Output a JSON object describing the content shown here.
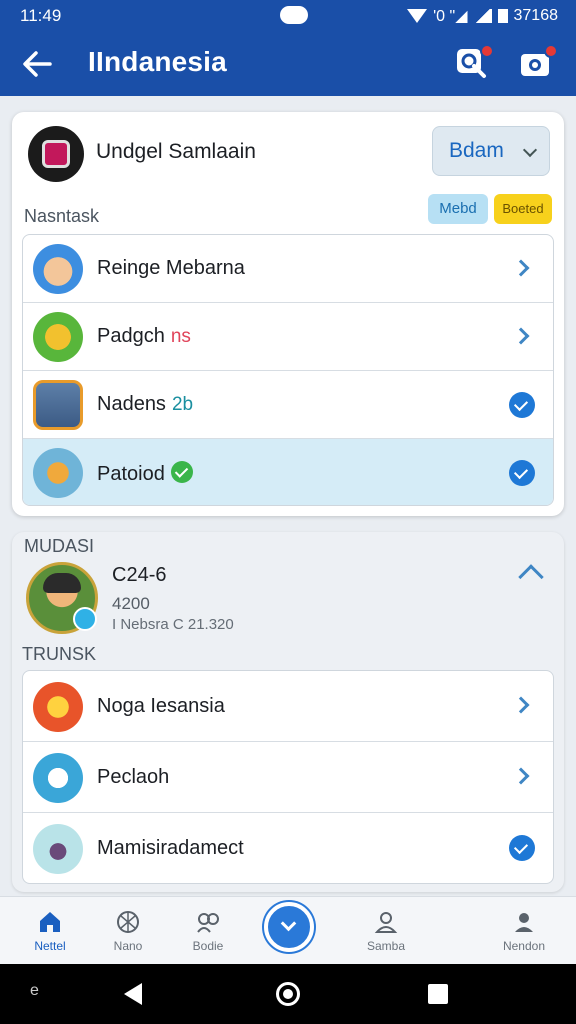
{
  "status_bar": {
    "time": "11:49",
    "right_text": "'0 \"◢",
    "battery_text": "37168"
  },
  "header": {
    "title": "IIndanesia",
    "back_icon": "arrow-left-icon",
    "actions": [
      {
        "icon": "search-icon"
      },
      {
        "icon": "camera-icon"
      }
    ]
  },
  "profile": {
    "name": "Undgel Samlaain",
    "dropdown_value": "Bdam"
  },
  "section1": {
    "label": "Nasntask",
    "chips": [
      "Mebd",
      "Boeted"
    ],
    "items": [
      {
        "label": "Reinge Mebarna",
        "badge": "",
        "trailing": "chevron"
      },
      {
        "label": "Padgch",
        "badge": "ns",
        "trailing": "chevron"
      },
      {
        "label": "Nadens",
        "badge": "2b",
        "trailing": "check"
      },
      {
        "label": "Patoiod",
        "badge": "",
        "trailing": "check"
      }
    ]
  },
  "section2": {
    "label": "MUDASI",
    "user": {
      "line1": "C24-6",
      "line2": "4200",
      "line3": "I Nebsra C 21.320"
    },
    "sub_label": "TRUNSK",
    "items": [
      {
        "label": "Noga Iesansia",
        "trailing": "chevron"
      },
      {
        "label": "Peclaoh",
        "trailing": "chevron"
      },
      {
        "label": "Mamisiradamect",
        "trailing": "check"
      }
    ]
  },
  "bottom_nav": [
    {
      "label": "Nettel",
      "icon": "home-icon"
    },
    {
      "label": "Nano",
      "icon": "globe-icon"
    },
    {
      "label": "Bodie",
      "icon": "users-icon"
    },
    {
      "label": "Samba",
      "icon": "person-icon"
    },
    {
      "label": "Nendon",
      "icon": "account-icon"
    }
  ],
  "colors": {
    "primary": "#1a4fa8",
    "accent": "#1e78d6",
    "selected_row": "#d5ecf7",
    "chip_yellow": "#f7d11c"
  }
}
